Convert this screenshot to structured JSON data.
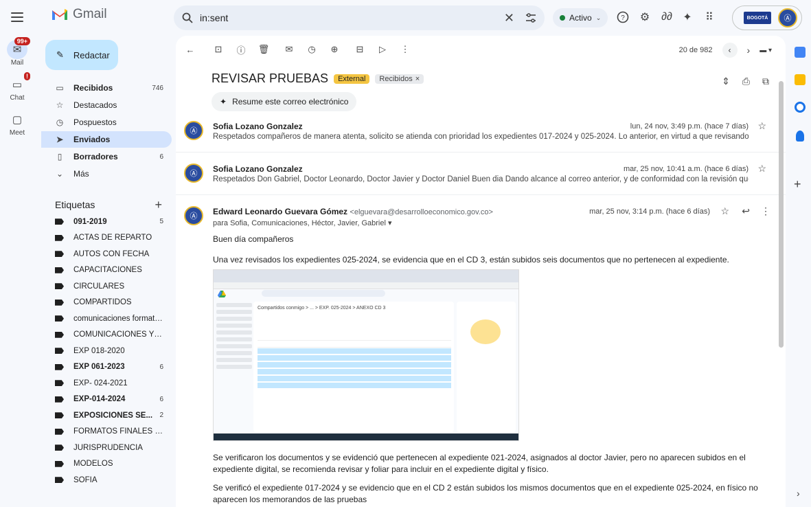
{
  "app": {
    "name": "Gmail"
  },
  "search": {
    "value": "in:sent"
  },
  "status": {
    "label": "Activo"
  },
  "org_badge": "BOGOTÁ",
  "rail": [
    {
      "label": "Mail",
      "badge": "99+"
    },
    {
      "label": "Chat",
      "badge": ""
    },
    {
      "label": "Meet",
      "badge": ""
    }
  ],
  "sidebar": {
    "compose": "Redactar",
    "nav": [
      {
        "label": "Recibidos",
        "count": "746",
        "icon": "inbox-icon",
        "bold": true
      },
      {
        "label": "Destacados",
        "count": "",
        "icon": "star-icon",
        "bold": false
      },
      {
        "label": "Pospuestos",
        "count": "",
        "icon": "clock-icon",
        "bold": false
      },
      {
        "label": "Enviados",
        "count": "",
        "icon": "send-icon",
        "bold": true,
        "active": true
      },
      {
        "label": "Borradores",
        "count": "6",
        "icon": "draft-icon",
        "bold": true
      },
      {
        "label": "Más",
        "count": "",
        "icon": "chevron-down-icon",
        "bold": false
      }
    ],
    "labels_title": "Etiquetas",
    "labels": [
      {
        "label": "091-2019",
        "count": "5",
        "bold": true
      },
      {
        "label": "ACTAS DE REPARTO",
        "count": "",
        "bold": false
      },
      {
        "label": "AUTOS CON FECHA",
        "count": "",
        "bold": false
      },
      {
        "label": "CAPACITACIONES",
        "count": "",
        "bold": false
      },
      {
        "label": "CIRCULARES",
        "count": "",
        "bold": false
      },
      {
        "label": "COMPARTIDOS",
        "count": "",
        "bold": false
      },
      {
        "label": "comunicaciones formato...",
        "count": "",
        "bold": false
      },
      {
        "label": "COMUNICACIONES Y/O ...",
        "count": "",
        "bold": false
      },
      {
        "label": "EXP 018-2020",
        "count": "",
        "bold": false
      },
      {
        "label": "EXP 061-2023",
        "count": "6",
        "bold": true
      },
      {
        "label": "EXP- 024-2021",
        "count": "",
        "bold": false
      },
      {
        "label": "EXP-014-2024",
        "count": "6",
        "bold": true
      },
      {
        "label": "EXPOSICIONES SE...",
        "count": "2",
        "bold": true
      },
      {
        "label": "FORMATOS FINALES PR...",
        "count": "",
        "bold": false
      },
      {
        "label": "JURISPRUDENCIA",
        "count": "",
        "bold": false
      },
      {
        "label": "MODELOS",
        "count": "",
        "bold": false
      },
      {
        "label": "SOFÍA",
        "count": "",
        "bold": false
      }
    ]
  },
  "toolbar": {
    "pager": "20 de 982"
  },
  "thread": {
    "subject": "REVISAR PRUEBAS",
    "chip_external": "External",
    "chip_inbox": "Recibidos",
    "chip_inbox_close": "×",
    "summarize": "Resume este correo electrónico",
    "messages": [
      {
        "sender": "Sofia Lozano Gonzalez",
        "date": "lun, 24 nov, 3:49 p.m. (hace 7 días)",
        "snippet": "Respetados compañeros de manera atenta, solicito se atienda con prioridad los expedientes 017-2024 y 025-2024. Lo anterior, en virtud a que revisando la suscrit"
      },
      {
        "sender": "Sofia Lozano Gonzalez",
        "date": "mar, 25 nov, 10:41 a.m. (hace 6 días)",
        "snippet": "Respetados Don Gabriel, Doctor Leonardo, Doctor Javier y Doctor Daniel Buen dia Dando alcance al correo anterior, y de conformidad con la revisión que ha realiz"
      }
    ],
    "open": {
      "sender": "Edward Leonardo Guevara Gómez",
      "email": "<elguevara@desarrolloeconomico.gov.co>",
      "date": "mar, 25 nov, 3:14 p.m. (hace 6 días)",
      "to": "para Sofia, Comunicaciones, Héctor, Javier, Gabriel",
      "greeting": "Buen día compañeros",
      "p1": "Una vez revisados los expedientes 025-2024, se evidencia que en el CD 3, están subidos seis documentos que no pertenecen al expediente.",
      "p2": "Se verificaron los documentos y se evidenció que pertenecen al expediente 021-2024, asignados al doctor Javier, pero no aparecen subidos en el expediente digital, se recomienda revisar y foliar para incluir en el expediente digital y físico.",
      "p3": "Se verificó el expediente 017-2024 y se evidencio que en el CD 2 están subidos los mismos documentos que en el expediente 025-2024, en físico no aparecen los memorandos de las pruebas"
    },
    "embed": {
      "breadcrumb": "Compartidos conmigo  >  ...  >  EXP. 025-2024  >  ANEXO CD 3"
    }
  },
  "colors": {
    "accent": "#c2e7ff",
    "active_nav": "#d3e3fd",
    "external": "#f4c542"
  }
}
